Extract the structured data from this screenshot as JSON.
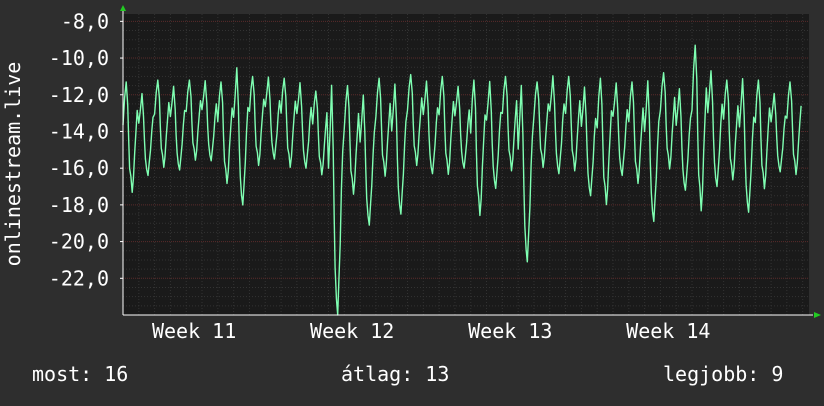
{
  "colors": {
    "background": "#2e2e2e",
    "plot_background": "#1a1a1a",
    "grid_major": "#5a2a2a",
    "grid_minor": "#333333",
    "line": "#7fffb2",
    "axis_arrow": "#22cc22",
    "text": "#ffffff"
  },
  "footer": {
    "current": "most: 16",
    "average": "átlag: 13",
    "best": "legjobb: 9"
  },
  "chart_data": {
    "type": "line",
    "ylabel": "onlinestream.live",
    "ylim": [
      -24.0,
      -7.6
    ],
    "yticks": [
      -8,
      -10,
      -12,
      -14,
      -16,
      -18,
      -20,
      -22
    ],
    "ytick_labels": [
      "-8,0",
      "-10,0",
      "-12,0",
      "-14,0",
      "-16,0",
      "-18,0",
      "-20,0",
      "-22,0"
    ],
    "xlim": [
      0,
      43.4
    ],
    "xticks": [
      {
        "x": 4.5,
        "label": "Week 11"
      },
      {
        "x": 14.5,
        "label": "Week 12"
      },
      {
        "x": 24.5,
        "label": "Week 13"
      },
      {
        "x": 34.5,
        "label": "Week 14"
      }
    ],
    "grid": true,
    "series": [
      {
        "name": "",
        "daily_peak": [
          -11.3,
          -11.8,
          -11.2,
          -11.4,
          -11.2,
          -11.1,
          -11.3,
          -10.3,
          -11.0,
          -10.9,
          -11.1,
          -11.2,
          -11.8,
          -11.1,
          -11.5,
          -11.8,
          -11.1,
          -11.2,
          -10.9,
          -11.1,
          -11.0,
          -11.4,
          -11.2,
          -11.1,
          -11.0,
          -11.2,
          -11.3,
          -10.8,
          -11.0,
          -11.4,
          -11.1,
          -11.2,
          -11.3,
          -11.0,
          -10.8,
          -11.5,
          -9.3,
          -10.5,
          -11.2,
          -10.9,
          -11.2,
          -11.8,
          -11.3
        ],
        "daily_trough": [
          -17.5,
          -16.4,
          -16.1,
          -16.1,
          -15.7,
          -15.6,
          -17.0,
          -18.0,
          -16.0,
          -15.5,
          -16.1,
          -16.0,
          -16.5,
          -24.0,
          -17.6,
          -19.1,
          -16.6,
          -18.5,
          -16.0,
          -16.3,
          -16.5,
          -16.0,
          -18.8,
          -17.1,
          -16.3,
          -21.1,
          -16.1,
          -16.3,
          -16.3,
          -17.5,
          -18.2,
          -16.4,
          -17.0,
          -18.9,
          -16.2,
          -17.2,
          -18.6,
          -17.0,
          -16.8,
          -18.4,
          -17.3,
          -16.2,
          -16.5
        ]
      }
    ]
  }
}
